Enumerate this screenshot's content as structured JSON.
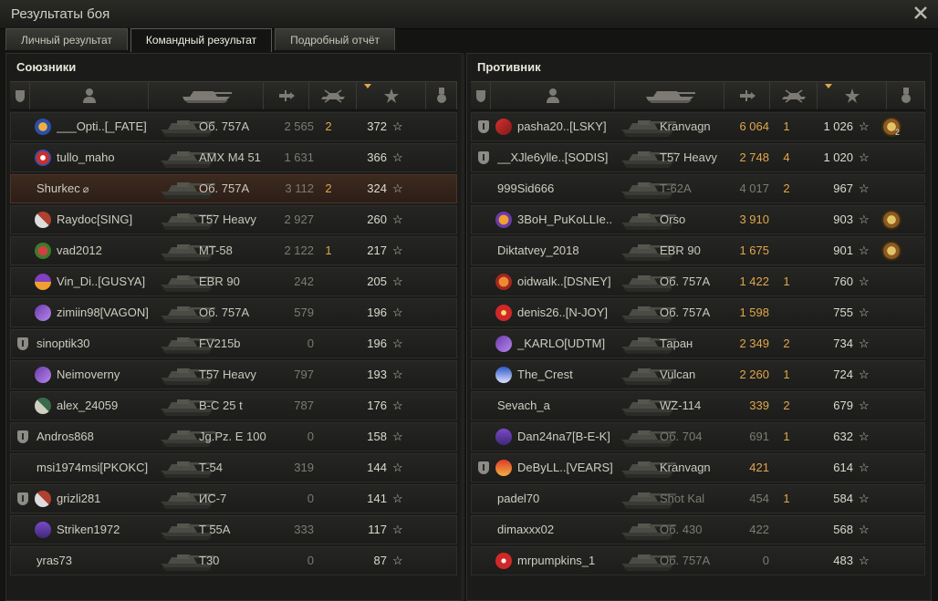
{
  "window": {
    "title": "Результаты боя"
  },
  "tabs": [
    {
      "label": "Личный результат",
      "active": false
    },
    {
      "label": "Командный результат",
      "active": true
    },
    {
      "label": "Подробный отчёт",
      "active": false
    }
  ],
  "allies": {
    "title": "Союзники",
    "players": [
      {
        "platoon": false,
        "emblem": "blue-orange",
        "name": "___Opti..[_FATE]",
        "vehicle": "Об. 757А",
        "damage": "2 565",
        "kills": "2",
        "xp": "372",
        "medal": false,
        "dim": true
      },
      {
        "platoon": false,
        "emblem": "red-blue",
        "name": "tullo_maho",
        "vehicle": "AMX M4 51",
        "damage": "1 631",
        "kills": "",
        "xp": "366",
        "medal": false,
        "dim": true
      },
      {
        "platoon": false,
        "emblem": "",
        "name": "Shurkec",
        "vehicle": "Об. 757А",
        "damage": "3 112",
        "kills": "2",
        "xp": "324",
        "medal": false,
        "dim": true,
        "me": true
      },
      {
        "platoon": false,
        "emblem": "diamond",
        "name": "Raydoc[SING]",
        "vehicle": "T57 Heavy",
        "damage": "2 927",
        "kills": "",
        "xp": "260",
        "medal": false,
        "dim": true
      },
      {
        "platoon": false,
        "emblem": "red-green",
        "name": "vad2012",
        "vehicle": "MT-58",
        "damage": "2 122",
        "kills": "1",
        "xp": "217",
        "medal": false,
        "dim": true
      },
      {
        "platoon": false,
        "emblem": "purple-orange",
        "name": "Vin_Di..[GUSYA]",
        "vehicle": "EBR 90",
        "damage": "242",
        "kills": "",
        "xp": "205",
        "medal": false,
        "dim": true
      },
      {
        "platoon": false,
        "emblem": "purple",
        "name": "zimiin98[VAGON]",
        "vehicle": "Об. 757А",
        "damage": "579",
        "kills": "",
        "xp": "196",
        "medal": false,
        "dim": true
      },
      {
        "platoon": true,
        "emblem": "",
        "name": "sinoptik30",
        "vehicle": "FV215b",
        "damage": "0",
        "kills": "",
        "xp": "196",
        "medal": false,
        "dim": true
      },
      {
        "platoon": false,
        "emblem": "purple",
        "name": "Neimoverny",
        "vehicle": "T57 Heavy",
        "damage": "797",
        "kills": "",
        "xp": "193",
        "medal": false,
        "dim": true
      },
      {
        "platoon": false,
        "emblem": "green-diamond",
        "name": "alex_24059",
        "vehicle": "B-C 25 t",
        "damage": "787",
        "kills": "",
        "xp": "176",
        "medal": false,
        "dim": true
      },
      {
        "platoon": true,
        "emblem": "",
        "name": "Andros868",
        "vehicle": "Jg.Pz. E 100",
        "damage": "0",
        "kills": "",
        "xp": "158",
        "medal": false,
        "dim": true
      },
      {
        "platoon": false,
        "emblem": "",
        "name": "msi1974msi[PKOKC]",
        "vehicle": "T-54",
        "damage": "319",
        "kills": "",
        "xp": "144",
        "medal": false,
        "dim": true
      },
      {
        "platoon": true,
        "emblem": "diamond",
        "name": "grizli281",
        "vehicle": "ИС-7",
        "damage": "0",
        "kills": "",
        "xp": "141",
        "medal": false,
        "dim": true
      },
      {
        "platoon": false,
        "emblem": "triangle",
        "name": "Striken1972",
        "vehicle": "T 55A",
        "damage": "333",
        "kills": "",
        "xp": "117",
        "medal": false,
        "dim": true
      },
      {
        "platoon": false,
        "emblem": "",
        "name": "yras73",
        "vehicle": "T30",
        "damage": "0",
        "kills": "",
        "xp": "87",
        "medal": false,
        "dim": true
      }
    ]
  },
  "enemies": {
    "title": "Противник",
    "players": [
      {
        "platoon": true,
        "emblem": "red-flag",
        "name": "pasha20..[LSKY]",
        "vehicle": "Kranvagn",
        "damage": "6 064",
        "kills": "1",
        "xp": "1 026",
        "medal": true,
        "medal_count": "2",
        "dim": false
      },
      {
        "platoon": true,
        "emblem": "",
        "name": "__XJle6ylle..[SODIS]",
        "vehicle": "T57 Heavy",
        "damage": "2 748",
        "kills": "4",
        "xp": "1 020",
        "medal": false,
        "dim": false
      },
      {
        "platoon": false,
        "emblem": "",
        "name": "999Sid666",
        "vehicle": "T-62A",
        "damage": "4 017",
        "kills": "2",
        "xp": "967",
        "medal": false,
        "dim": true
      },
      {
        "platoon": false,
        "emblem": "orange-purple",
        "name": "3BoH_PuKoLLIe..",
        "vehicle": "Orso",
        "damage": "3 910",
        "kills": "",
        "xp": "903",
        "medal": true,
        "medal_count": "",
        "dim": false
      },
      {
        "platoon": false,
        "emblem": "",
        "name": "Diktatvey_2018",
        "vehicle": "EBR 90",
        "damage": "1 675",
        "kills": "",
        "xp": "901",
        "medal": true,
        "medal_count": "",
        "dim": false
      },
      {
        "platoon": false,
        "emblem": "orange-red",
        "name": "oidwalk..[DSNEY]",
        "vehicle": "Об. 757А",
        "damage": "1 422",
        "kills": "1",
        "xp": "760",
        "medal": false,
        "dim": false
      },
      {
        "platoon": false,
        "emblem": "red-star",
        "name": "denis26..[N-JOY]",
        "vehicle": "Об. 757А",
        "damage": "1 598",
        "kills": "",
        "xp": "755",
        "medal": false,
        "dim": false
      },
      {
        "platoon": false,
        "emblem": "purple",
        "name": "_KARLO[UDTM]",
        "vehicle": "Таран",
        "damage": "2 349",
        "kills": "2",
        "xp": "734",
        "medal": false,
        "dim": false
      },
      {
        "platoon": false,
        "emblem": "blue-white",
        "name": "The_Crest",
        "vehicle": "Vulcan",
        "damage": "2 260",
        "kills": "1",
        "xp": "724",
        "medal": false,
        "dim": false
      },
      {
        "platoon": false,
        "emblem": "",
        "name": "Sevach_a",
        "vehicle": "WZ-114",
        "damage": "339",
        "kills": "2",
        "xp": "679",
        "medal": false,
        "dim": false
      },
      {
        "platoon": false,
        "emblem": "triangle",
        "name": "Dan24na7[B-E-K]",
        "vehicle": "Об. 704",
        "damage": "691",
        "kills": "1",
        "xp": "632",
        "medal": false,
        "dim": true
      },
      {
        "platoon": true,
        "emblem": "red-triangle",
        "name": "DeByLL..[VEARS]",
        "vehicle": "Kranvagn",
        "damage": "421",
        "kills": "",
        "xp": "614",
        "medal": false,
        "dim": false
      },
      {
        "platoon": false,
        "emblem": "",
        "name": "padel70",
        "vehicle": "Shot Kal",
        "damage": "454",
        "kills": "1",
        "xp": "584",
        "medal": false,
        "dim": true
      },
      {
        "platoon": false,
        "emblem": "",
        "name": "dimaxxx02",
        "vehicle": "Об. 430",
        "damage": "422",
        "kills": "",
        "xp": "568",
        "medal": false,
        "dim": true
      },
      {
        "platoon": false,
        "emblem": "red-round",
        "name": "mrpumpkins_1",
        "vehicle": "Об. 757А",
        "damage": "0",
        "kills": "",
        "xp": "483",
        "medal": false,
        "dim": true
      }
    ]
  },
  "icons": {
    "close": "close-icon",
    "platoon": "platoon-icon",
    "player": "player-icon",
    "vehicle": "tank-icon",
    "damage": "damage-icon",
    "kills": "kills-icon",
    "xp": "star-icon",
    "medal": "medal-icon",
    "sort": "sort-arrow-icon"
  },
  "colors": {
    "accent": "#e0a64a",
    "background": "#141412",
    "me_row": "#3d2a1f"
  }
}
